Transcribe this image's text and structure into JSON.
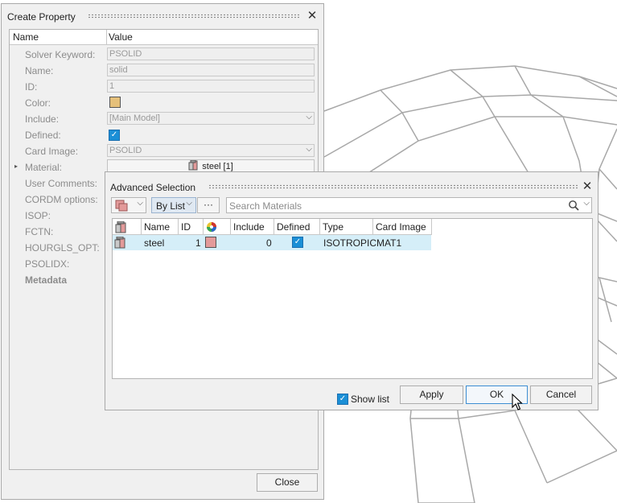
{
  "create_property": {
    "title": "Create Property",
    "columns": {
      "name": "Name",
      "value": "Value"
    },
    "rows": {
      "solver_keyword": {
        "label": "Solver Keyword:",
        "value": "PSOLID"
      },
      "name": {
        "label": "Name:",
        "value": "solid"
      },
      "id": {
        "label": "ID:",
        "value": "1"
      },
      "color": {
        "label": "Color:",
        "value": "#e5c07a"
      },
      "include": {
        "label": "Include:",
        "value": "[Main Model]"
      },
      "defined": {
        "label": "Defined:",
        "checked": true
      },
      "card_image": {
        "label": "Card Image:",
        "value": "PSOLID"
      },
      "material": {
        "label": "Material:",
        "value": "steel [1]"
      },
      "user_comments": {
        "label": "User Comments:"
      },
      "cordm_options": {
        "label": "CORDM options:"
      },
      "isop": {
        "label": "ISOP:"
      },
      "fctn": {
        "label": "FCTN:"
      },
      "hourgls_opt": {
        "label": "HOURGLS_OPT:"
      },
      "psolidx": {
        "label": "PSOLIDX:"
      },
      "metadata": {
        "label": "Metadata"
      }
    },
    "close_label": "Close"
  },
  "advanced_selection": {
    "title": "Advanced Selection",
    "mode": "By List",
    "more_label": "···",
    "search_placeholder": "Search Materials",
    "columns": [
      "Name",
      "ID",
      "Include",
      "Defined",
      "Type",
      "Card Image"
    ],
    "rows": [
      {
        "name": "steel",
        "id": "1",
        "color": "#e39a9a",
        "include": "0",
        "defined": true,
        "type": "ISOTROPIC",
        "card_image": "MAT1"
      }
    ],
    "show_list_label": "Show list",
    "show_list_checked": true,
    "apply_label": "Apply",
    "ok_label": "OK",
    "cancel_label": "Cancel"
  }
}
